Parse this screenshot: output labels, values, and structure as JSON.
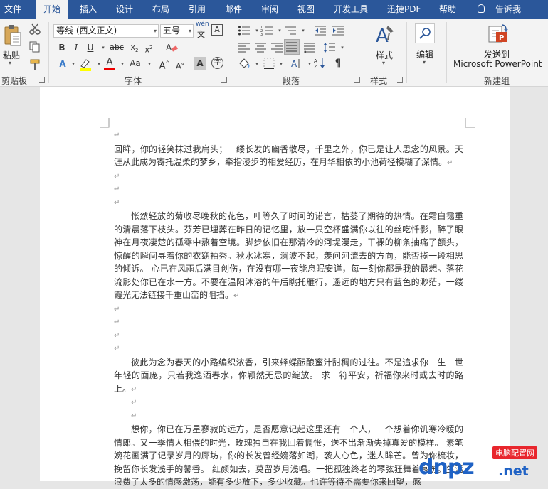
{
  "tabs": [
    {
      "label": "文件",
      "active": false
    },
    {
      "label": "开始",
      "active": true
    },
    {
      "label": "插入",
      "active": false
    },
    {
      "label": "设计",
      "active": false
    },
    {
      "label": "布局",
      "active": false
    },
    {
      "label": "引用",
      "active": false
    },
    {
      "label": "邮件",
      "active": false
    },
    {
      "label": "审阅",
      "active": false
    },
    {
      "label": "视图",
      "active": false
    },
    {
      "label": "开发工具",
      "active": false
    },
    {
      "label": "迅捷PDF",
      "active": false
    },
    {
      "label": "帮助",
      "active": false
    }
  ],
  "tell_me": "告诉我",
  "clipboard": {
    "paste": "粘贴",
    "group": "剪贴板"
  },
  "font": {
    "name": "等线 (西文正文)",
    "size": "五号",
    "wen": "wén",
    "wen_sub": "文",
    "group": "字体",
    "aa": "Aa"
  },
  "paragraph": {
    "group": "段落"
  },
  "styles": {
    "label": "样式",
    "group": "样式"
  },
  "editing": {
    "label": "编辑"
  },
  "newgroup": {
    "line1": "发送到",
    "line2": "Microsoft PowerPoint",
    "group": "新建组"
  },
  "document": {
    "paragraphs": [
      {
        "type": "empty"
      },
      {
        "type": "text",
        "indent": false,
        "text": "回眸，你的轻笑抹过我肩头；一缕长发的幽香散尽，千里之外，你已是让人思念的风景。天涯从此成为寄托温柔的梦乡，牵指漫步的相爱经历，在月华相依的小池荷径模糊了深情。"
      },
      {
        "type": "empty"
      },
      {
        "type": "empty"
      },
      {
        "type": "empty"
      },
      {
        "type": "text",
        "indent": true,
        "text": "怅然轻放的菊收尽晚秋的花色，叶等久了时间的诺言，枯萎了期待的热情。在霜白霭重的清晨落下枝头。芬芳已埋葬在昨日的记忆里，放一只空杯盛满你以往的丝呓忏影，醉了眼神在月夜凄楚的孤零中熬着空境。脚步依旧在那清冷的河堤漫走，干裸的柳条抽痛了额头，惊醒的瞬间寻着你的衣窈袖秀。秋水冰寒，澜波不起，羡问河流去的方向，能否揽一段相思的倾诉。      心已在风雨后满目创伤，在没有哪一夜能息眠安详，每一刻你都是我的最想。落花流影处你已在水一方。不要在温阳沐浴的午后眺托雁行，遥远的地方只有蓝色的渺茫，一缕霞光无法链接千重山峦的阻挡。"
      },
      {
        "type": "empty"
      },
      {
        "type": "empty"
      },
      {
        "type": "empty"
      },
      {
        "type": "empty"
      },
      {
        "type": "text",
        "indent": true,
        "text": "彼此为念为春天的小路编织浓香，引来蜂蝶酝酿蜜汁甜稠的过往。不是追求你一生一世年轻的面庞，只若我逸洒春水，你颖然无忌的绽放。      求一符平安，祈福你来时或去时的路上。"
      },
      {
        "type": "empty"
      },
      {
        "type": "empty"
      },
      {
        "type": "text",
        "indent": true,
        "text": "想你，你已在万星寥寂的远方，是否愿意记起这里还有一个人，一个想着你饥寒冷暖的情郎。又一季情人相偎的时光，玫瑰独自在我回着惆怅，送不出渐渐失掉真爱的模样。      素笔婉花画满了记录岁月的廊坊，你的长发曾经婉落如潮，袭人心色，迷人眸芒。曾为你梳妆，挽留你长发浅手的馨香。      红颜如去，莫留岁月浅唱。一把孤独终老的琴弦狂舞着哀伤。生活浪费了太多的情感激荡，能有多少放下，多少收藏。也许等待不需要你来回望，感"
      }
    ]
  },
  "watermark": {
    "badge": "电脑配置网",
    "logo": "dnpz",
    ".net": ".net"
  }
}
